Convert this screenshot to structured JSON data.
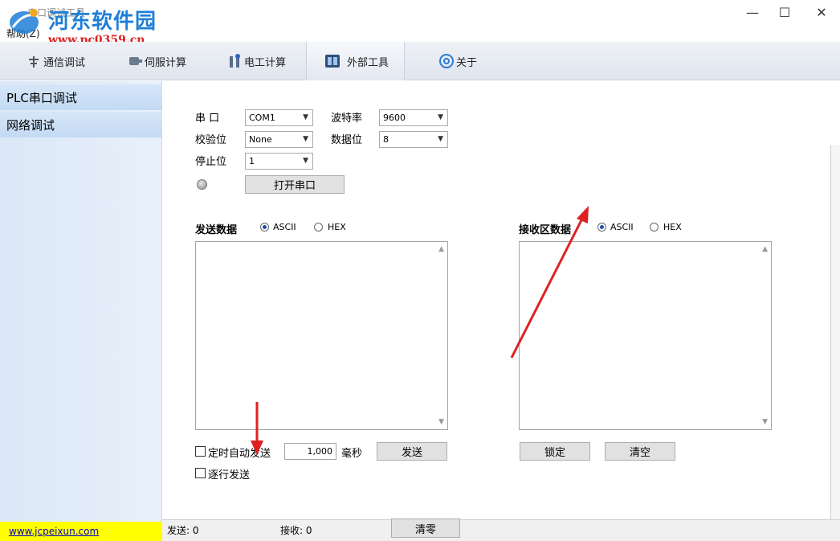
{
  "window": {
    "title": "串口调试工具",
    "menu_help": "帮助(Z)",
    "minimize": "—",
    "maximize": "☐",
    "close": "✕"
  },
  "watermark": {
    "title": "河东软件园",
    "url": "www.pc0359.cn"
  },
  "toolbar": {
    "tabs": [
      {
        "label": "通信调试",
        "icon": "antenna-icon"
      },
      {
        "label": "伺服计算",
        "icon": "motor-icon"
      },
      {
        "label": "电工计算",
        "icon": "tools-icon"
      },
      {
        "label": "外部工具",
        "icon": "panel-icon",
        "active": true
      },
      {
        "label": "关于",
        "icon": "at-icon"
      }
    ]
  },
  "sidebar": {
    "items": [
      {
        "label": "PLC串口调试"
      },
      {
        "label": "网络调试"
      }
    ],
    "link": "www.jcpeixun.com"
  },
  "serial": {
    "port_label": "串  口",
    "port_value": "COM1",
    "baud_label": "波特率",
    "baud_value": "9600",
    "parity_label": "校验位",
    "parity_value": "None",
    "databits_label": "数据位",
    "databits_value": "8",
    "stopbits_label": "停止位",
    "stopbits_value": "1",
    "open_button": "打开串口"
  },
  "send": {
    "title": "发送数据",
    "ascii": "ASCII",
    "hex": "HEX",
    "auto_send": "定时自动发送",
    "interval": "1,000",
    "unit": "毫秒",
    "send_button": "发送",
    "line_send": "逐行发送"
  },
  "receive": {
    "title": "接收区数据",
    "ascii": "ASCII",
    "hex": "HEX",
    "lock_button": "锁定",
    "clear_button": "清空"
  },
  "status": {
    "sent": "发送: 0",
    "received": "接收: 0",
    "reset_button": "清零"
  },
  "colors": {
    "arrow": "#e02020",
    "watermark_blue": "#1e7fd8",
    "link_bg": "#ffff00"
  }
}
